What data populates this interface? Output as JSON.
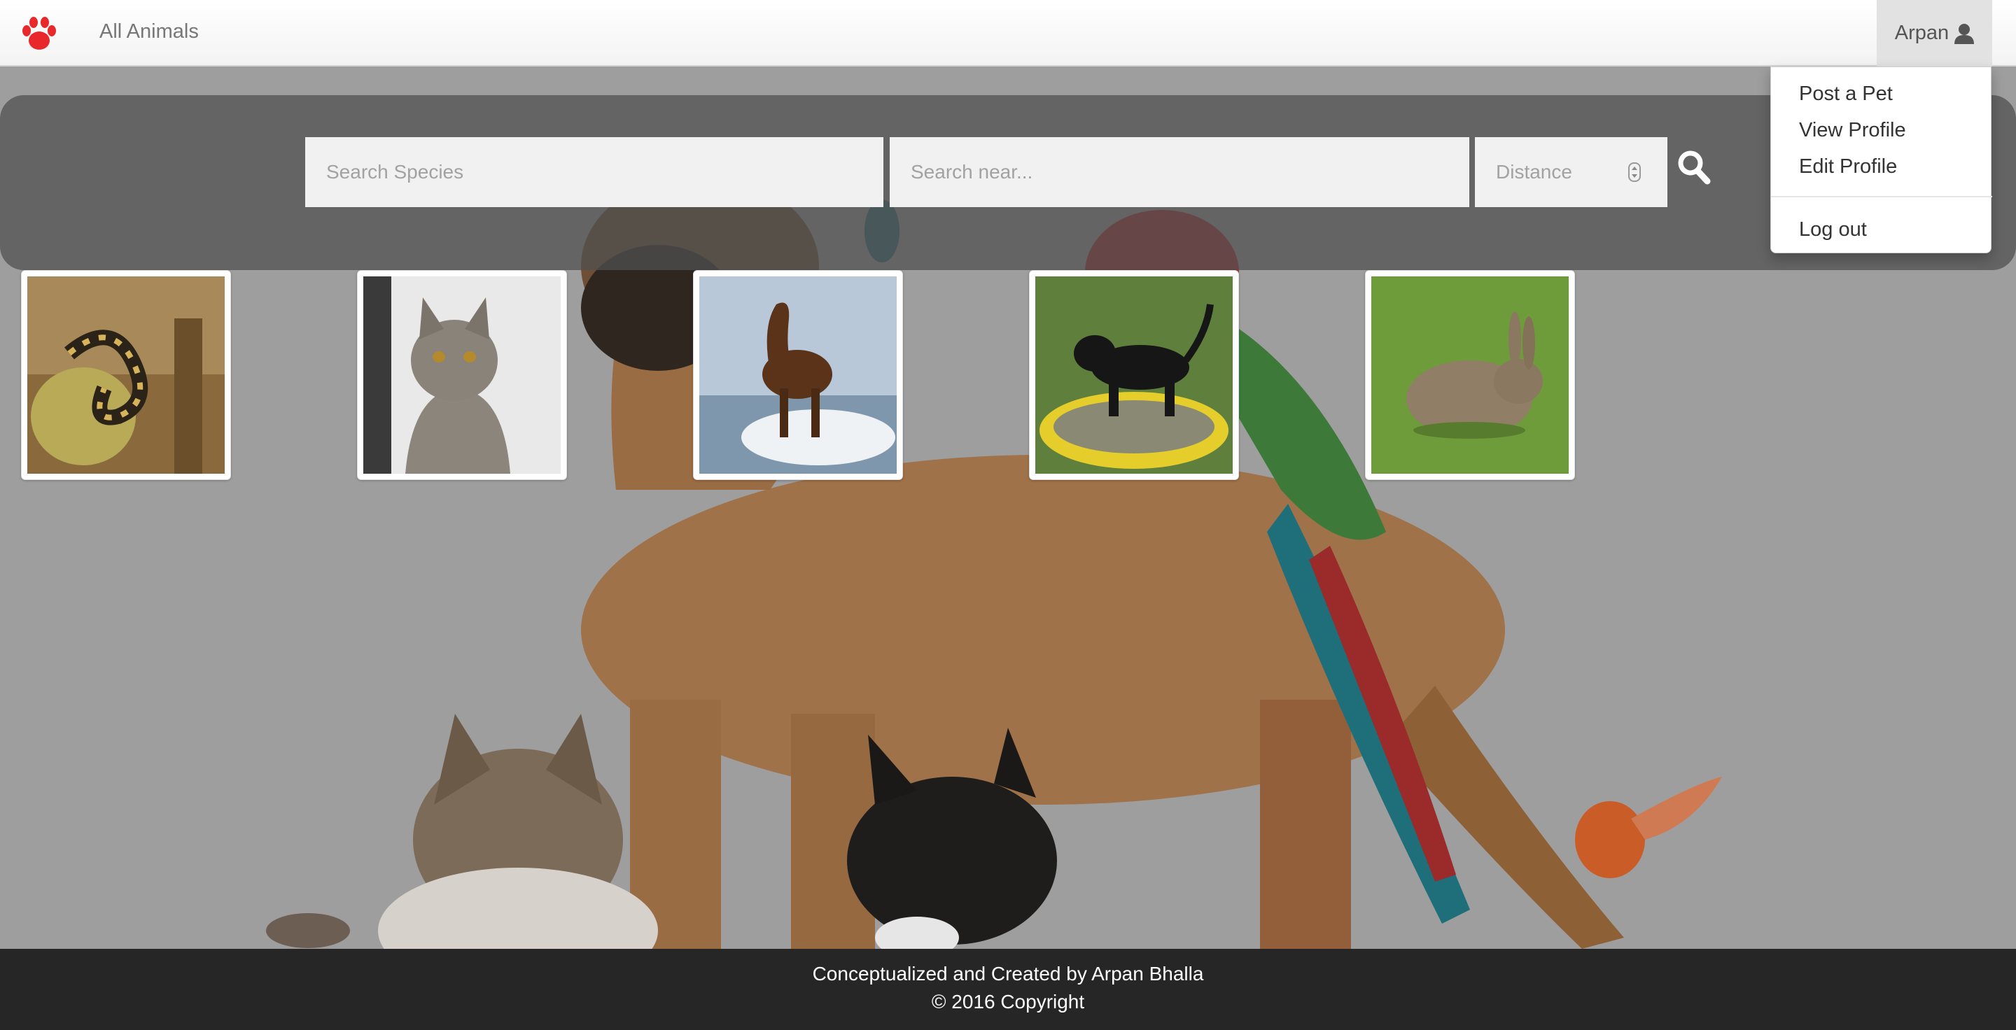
{
  "navbar": {
    "brand_icon": "paw-icon",
    "brand_color": "#e8282b",
    "nav_link": "All Animals",
    "user_name": "Arpan",
    "user_icon": "user-icon"
  },
  "user_dropdown": {
    "items": [
      "Post a Pet",
      "View Profile",
      "Edit Profile"
    ],
    "logout": "Log out"
  },
  "search": {
    "species_placeholder": "Search Species",
    "location_placeholder": "Search near...",
    "distance_placeholder": "Distance",
    "button_icon": "search-icon"
  },
  "pets": [
    {
      "animal": "snake"
    },
    {
      "animal": "cat"
    },
    {
      "animal": "horse"
    },
    {
      "animal": "dog"
    },
    {
      "animal": "rabbit"
    }
  ],
  "footer": {
    "credit": "Conceptualized and Created by Arpan Bhalla",
    "copyright": "© 2016 Copyright"
  }
}
